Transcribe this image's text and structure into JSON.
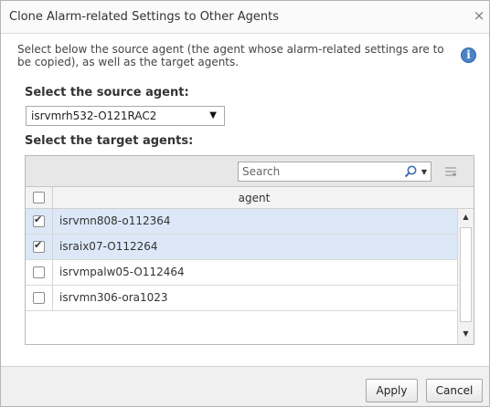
{
  "dialog": {
    "title": "Clone Alarm-related Settings to Other Agents",
    "close_glyph": "×"
  },
  "description": "Select below the source agent (the agent whose alarm-related settings are to be copied), as well as the target agents.",
  "info_icon_glyph": "i",
  "source": {
    "label": "Select the source agent:",
    "selected_value": "isrvmrh532-O121RAC2",
    "arrow_glyph": "▼"
  },
  "target": {
    "label": "Select the target agents:",
    "search_placeholder": "Search",
    "column_header": "agent",
    "rows": [
      {
        "name": "isrvmn808-o112364",
        "checked": true
      },
      {
        "name": "israix07-O112264",
        "checked": true
      },
      {
        "name": "isrvmpalw05-O112464",
        "checked": false
      },
      {
        "name": "isrvmn306-ora1023",
        "checked": false
      }
    ]
  },
  "footer": {
    "apply_label": "Apply",
    "cancel_label": "Cancel"
  },
  "colors": {
    "selected_row": "#dce8f7",
    "info_blue": "#4a84c4"
  },
  "icons": [
    "close-icon",
    "info-icon",
    "dropdown-arrow-icon",
    "search-icon",
    "column-menu-icon",
    "checkbox-icon",
    "scroll-up-icon",
    "scroll-down-icon"
  ]
}
